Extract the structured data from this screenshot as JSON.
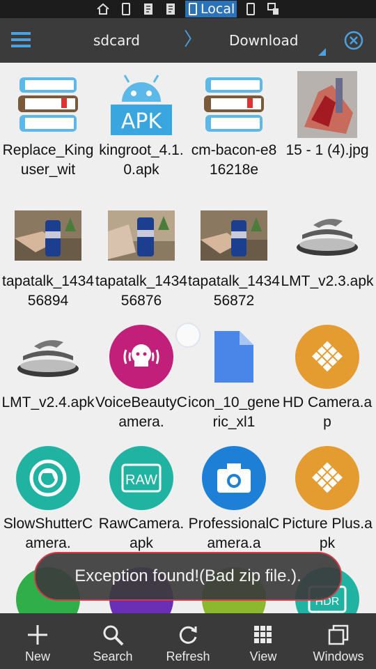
{
  "status_bar": {
    "local_label": "Local"
  },
  "header": {
    "root": "sdcard",
    "separator": "〉",
    "current": "Download"
  },
  "files": [
    {
      "name": "Replace_Kinguser_wit",
      "icon": "book-stack-icon"
    },
    {
      "name": "kingroot_4.1.0.apk",
      "icon": "apk-android-icon",
      "badge": "APK"
    },
    {
      "name": "cm-bacon-e816218e",
      "icon": "book-stack-icon"
    },
    {
      "name": "15 - 1 (4).jpg",
      "icon": "photo-thumbnail"
    },
    {
      "name": "tapatalk_143456894",
      "icon": "photo-thumbnail"
    },
    {
      "name": "tapatalk_143456876",
      "icon": "photo-thumbnail"
    },
    {
      "name": "tapatalk_143456872",
      "icon": "photo-thumbnail"
    },
    {
      "name": "LMT_v2.3.apk",
      "icon": "lmt-icon"
    },
    {
      "name": "LMT_v2.4.apk",
      "icon": "lmt-icon"
    },
    {
      "name": "VoiceBeautyCamera.",
      "icon": "voice-beauty-icon",
      "color": "#c21f7a"
    },
    {
      "name": "icon_10_generic_xl1",
      "icon": "generic-file-icon",
      "color": "#4a86e8"
    },
    {
      "name": "HD Camera.ap",
      "icon": "diamond-grid-icon",
      "color": "#e49b2f"
    },
    {
      "name": "SlowShutterCamera.",
      "icon": "shutter-icon",
      "color": "#21b3a2"
    },
    {
      "name": "RawCamera.apk",
      "icon": "raw-icon",
      "color": "#21b3a2",
      "badge": "RAW"
    },
    {
      "name": "ProfessionalCamera.a",
      "icon": "camera-icon",
      "color": "#1e7fd6"
    },
    {
      "name": "Picture Plus.apk",
      "icon": "diamond-grid-icon",
      "color": "#e49b2f"
    }
  ],
  "partial_row_colors": [
    "#2fae4a",
    "#6a2fb5",
    "#8bb82f",
    "#21b3a2"
  ],
  "partial_row_badge": "HDR",
  "toast": {
    "message": "Exception found!(Bad zip file.)."
  },
  "toolbar": {
    "new": "New",
    "search": "Search",
    "refresh": "Refresh",
    "view": "View",
    "windows": "Windows"
  },
  "colors": {
    "accent": "#4aa3e0",
    "header_bg": "#3b3b3b",
    "toolbar_bg": "#3a3a3a",
    "toast_border": "#d23a4a"
  }
}
